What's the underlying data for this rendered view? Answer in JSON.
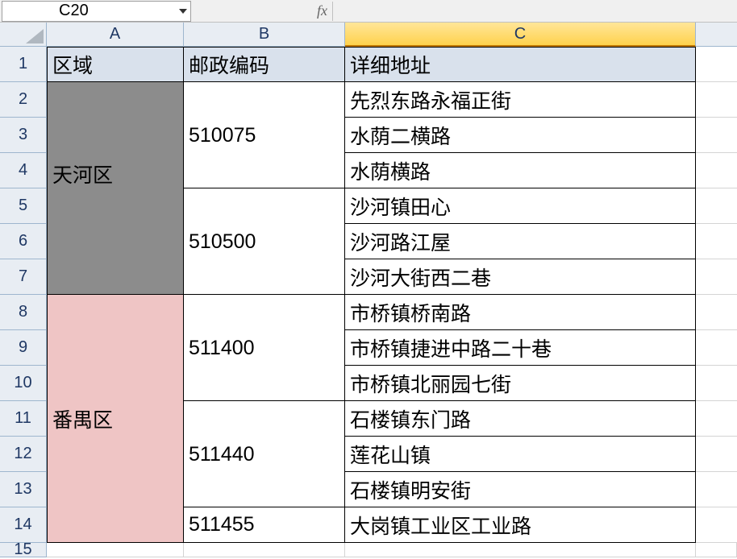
{
  "namebox": {
    "cell_reference": "C20",
    "fx_label": "fx"
  },
  "columns": {
    "a": "A",
    "b": "B",
    "c": "C"
  },
  "row_numbers": [
    "1",
    "2",
    "3",
    "4",
    "5",
    "6",
    "7",
    "8",
    "9",
    "10",
    "11",
    "12",
    "13",
    "14",
    "15"
  ],
  "headers": {
    "region": "区域",
    "postal": "邮政编码",
    "address": "详细地址"
  },
  "selected_column": "C",
  "data": [
    {
      "region": "天河区",
      "region_color": "#8c8c8c",
      "postal_groups": [
        {
          "postal": "510075",
          "addresses": [
            "先烈东路永福正街",
            "水荫二横路",
            "水荫横路"
          ]
        },
        {
          "postal": "510500",
          "addresses": [
            "沙河镇田心",
            "沙河路江屋",
            "沙河大街西二巷"
          ]
        }
      ]
    },
    {
      "region": "番禺区",
      "region_color": "#efc5c5",
      "postal_groups": [
        {
          "postal": "511400",
          "addresses": [
            "市桥镇桥南路",
            "市桥镇捷进中路二十巷",
            "市桥镇北丽园七街"
          ]
        },
        {
          "postal": "511440",
          "addresses": [
            "石楼镇东门路",
            "莲花山镇",
            "石楼镇明安街"
          ]
        },
        {
          "postal": "511455",
          "addresses": [
            "大岗镇工业区工业路"
          ]
        }
      ]
    }
  ]
}
